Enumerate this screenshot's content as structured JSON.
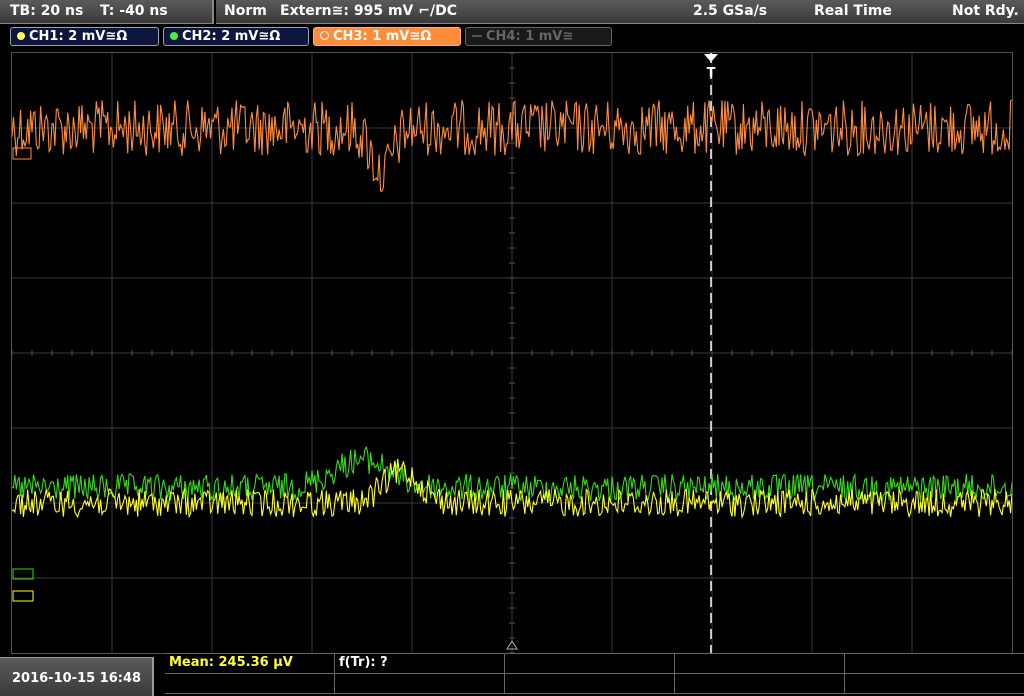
{
  "status": {
    "timebase": "TB: 20 ns",
    "trigger_time": "T: -40 ns",
    "mode": "Norm",
    "trigger_source": "Extern≅: 995 mV ⌐/DC",
    "sample_rate": "2.5 GSa/s",
    "acq_mode": "Real Time",
    "state": "Not Rdy."
  },
  "channels": [
    {
      "label": "CH1: 2 mV≅Ω",
      "color": "#ffff33",
      "active": false
    },
    {
      "label": "CH2: 2 mV≅Ω",
      "color": "#33dd33",
      "active": false
    },
    {
      "label": "CH3: 1 mV≅Ω",
      "color": "#ff8c3a",
      "active": true
    },
    {
      "label": "CH4: 1 mV≅",
      "color": "#777777",
      "active": false
    }
  ],
  "trigger_marker": "T",
  "footer": {
    "datetime": "2016-10-15 16:48",
    "mean": "Mean: 245.36 µV",
    "freq": "f(Tr): ?"
  },
  "colors": {
    "ch1": "#ffff22",
    "ch2": "#33dd11",
    "ch3": "#ff8c3a",
    "grid": "#3a3a3a"
  },
  "traces": {
    "ch3": {
      "level_div": 1.0,
      "dip_time_div": 3.7
    },
    "ch1": {
      "level_div": 6.0,
      "peak_time_div": 3.9
    },
    "ch2": {
      "level_div": 5.8,
      "peak_time_div": 3.5
    }
  }
}
